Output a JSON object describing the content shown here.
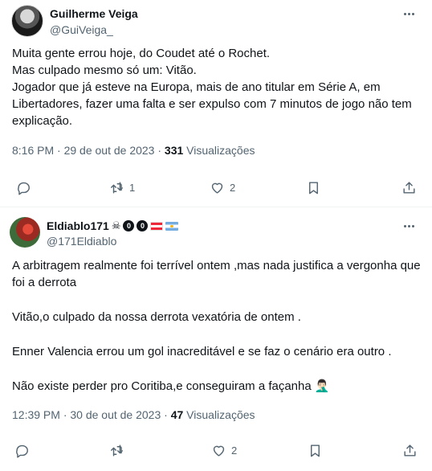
{
  "tweets": [
    {
      "display_name": "Guilherme Veiga",
      "handle": "@GuiVeiga_",
      "paragraphs": [
        "Muita gente errou hoje, do Coudet até o Rochet.",
        "Mas culpado mesmo só um: Vitão.",
        "Jogador que já esteve na Europa, mais de ano titular em Série A, em Libertadores, fazer uma falta e ser expulso com 7 minutos de jogo não tem explicação."
      ],
      "time": "8:16 PM · 29 de out de 2023 ·",
      "views_count": "331",
      "views_label": "Visualizações",
      "replies": "",
      "retweets": "1",
      "likes": "2"
    },
    {
      "display_name": "Eldiablo171",
      "handle": "@171Eldiablo",
      "name_badges": [
        "0",
        "0"
      ],
      "paragraphs": [
        "A arbitragem realmente foi terrível ontem ,mas nada justifica a vergonha que foi a derrota",
        "Vitão,o culpado da nossa derrota vexatória de ontem .",
        "Enner Valencia errou um gol inacreditável e se faz o cenário era outro .",
        "Não existe perder pro Coritiba,e conseguiram a façanha 🤦🏻‍♂️"
      ],
      "time": "12:39 PM · 30 de out de 2023 ·",
      "views_count": "47",
      "views_label": "Visualizações",
      "replies": "",
      "retweets": "",
      "likes": "2"
    }
  ],
  "icons": {
    "skull": "☠",
    "more": "more-horizontal-icon",
    "reply": "reply-icon",
    "retweet": "retweet-icon",
    "like": "heart-icon",
    "bookmark": "bookmark-icon",
    "share": "share-icon"
  },
  "colors": {
    "text": "#0f1419",
    "secondary": "#536471",
    "divider": "#eff3f4"
  }
}
